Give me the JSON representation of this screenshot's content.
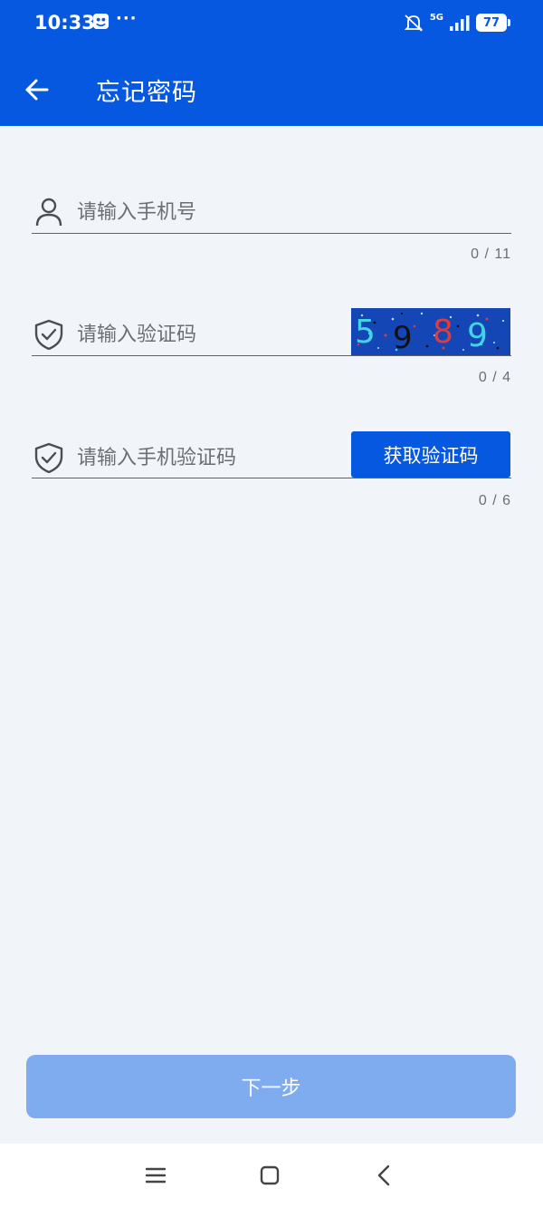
{
  "status_bar": {
    "time": "10:33",
    "more": "···",
    "network": "5G",
    "battery": "77"
  },
  "header": {
    "title": "忘记密码"
  },
  "form": {
    "phone": {
      "placeholder": "请输入手机号",
      "counter": "0 / 11",
      "icon": "user-icon"
    },
    "captcha": {
      "placeholder": "请输入验证码",
      "counter": "0 / 4",
      "icon": "shield-check-icon",
      "image_digits": [
        "5",
        "9",
        "8",
        "9"
      ]
    },
    "sms": {
      "placeholder": "请输入手机验证码",
      "counter": "0 / 6",
      "icon": "shield-check-icon",
      "button_label": "获取验证码"
    }
  },
  "footer": {
    "next_label": "下一步"
  },
  "colors": {
    "primary": "#0758e0",
    "next_disabled": "#7fabef",
    "background": "#f1f4f9"
  }
}
